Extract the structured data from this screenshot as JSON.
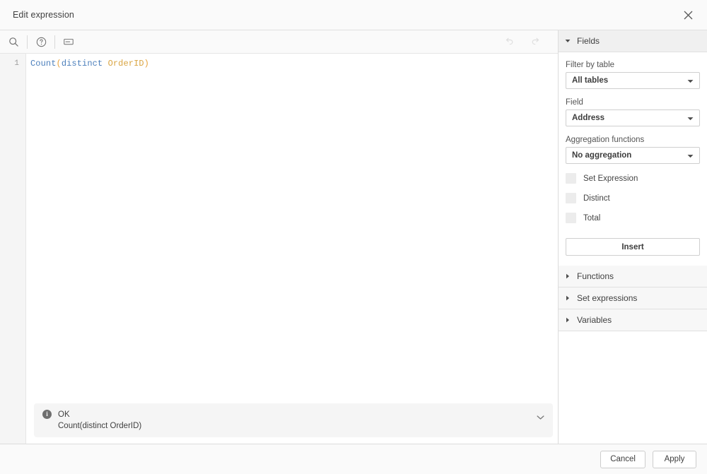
{
  "dialog": {
    "title": "Edit expression",
    "close_icon": "close-icon"
  },
  "toolbar": {
    "search_icon": "search-icon",
    "help_icon": "help-circle-icon",
    "comment_icon": "comment-icon",
    "undo_icon": "undo-icon",
    "redo_icon": "redo-icon"
  },
  "editor": {
    "line_number": "1",
    "tokens": {
      "func": "Count",
      "open_paren": "(",
      "keyword": "distinct",
      "space": " ",
      "field": "OrderID",
      "close_paren": ")"
    },
    "full_text": "Count(distinct OrderID)"
  },
  "status": {
    "icon": "info-icon",
    "glyph": "i",
    "state": "OK",
    "preview": "Count(distinct OrderID)",
    "chevron_icon": "chevron-down-icon"
  },
  "panel": {
    "fields_section": {
      "label": "Fields",
      "expanded": true,
      "filter_by_table_label": "Filter by table",
      "filter_by_table_value": "All tables",
      "field_label": "Field",
      "field_value": "Address",
      "aggregation_label": "Aggregation functions",
      "aggregation_value": "No aggregation",
      "checkboxes": [
        {
          "label": "Set Expression",
          "checked": false
        },
        {
          "label": "Distinct",
          "checked": false
        },
        {
          "label": "Total",
          "checked": false
        }
      ],
      "insert_label": "Insert"
    },
    "collapsed_sections": [
      {
        "label": "Functions"
      },
      {
        "label": "Set expressions"
      },
      {
        "label": "Variables"
      }
    ]
  },
  "footer": {
    "cancel_label": "Cancel",
    "apply_label": "Apply"
  },
  "colors": {
    "token_function": "#4a7ebb",
    "token_keyword": "#4a7ebb",
    "token_paren": "#e8a33d",
    "token_field": "#d9a441",
    "panel_header_bg": "#f0f0f0",
    "status_bg": "#f5f5f5"
  }
}
